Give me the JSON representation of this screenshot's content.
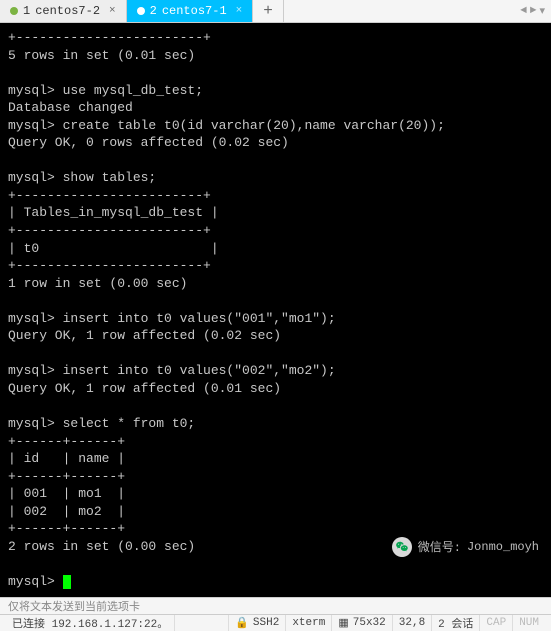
{
  "tabs": [
    {
      "index": "1",
      "label": "centos7-2",
      "active": false
    },
    {
      "index": "2",
      "label": "centos7-1",
      "active": true
    }
  ],
  "terminal_lines": [
    "+------------------------+",
    "5 rows in set (0.01 sec)",
    "",
    "mysql> use mysql_db_test;",
    "Database changed",
    "mysql> create table t0(id varchar(20),name varchar(20));",
    "Query OK, 0 rows affected (0.02 sec)",
    "",
    "mysql> show tables;",
    "+------------------------+",
    "| Tables_in_mysql_db_test |",
    "+------------------------+",
    "| t0                      |",
    "+------------------------+",
    "1 row in set (0.00 sec)",
    "",
    "mysql> insert into t0 values(\"001\",\"mo1\");",
    "Query OK, 1 row affected (0.02 sec)",
    "",
    "mysql> insert into t0 values(\"002\",\"mo2\");",
    "Query OK, 1 row affected (0.01 sec)",
    "",
    "mysql> select * from t0;",
    "+------+------+",
    "| id   | name |",
    "+------+------+",
    "| 001  | mo1  |",
    "| 002  | mo2  |",
    "+------+------+",
    "2 rows in set (0.00 sec)",
    "",
    "mysql> "
  ],
  "sendbar": {
    "hint": "仅将文本发送到当前选项卡"
  },
  "watermark": {
    "prefix": "微信号:",
    "id": "Jonmo_moyh"
  },
  "status": {
    "conn": "已连接 192.168.1.127:22。",
    "ssh": "SSH2",
    "term": "xterm",
    "size": "75x32",
    "pos": "32,8",
    "sess": "2 会话",
    "cap": "CAP",
    "num": "NUM"
  }
}
